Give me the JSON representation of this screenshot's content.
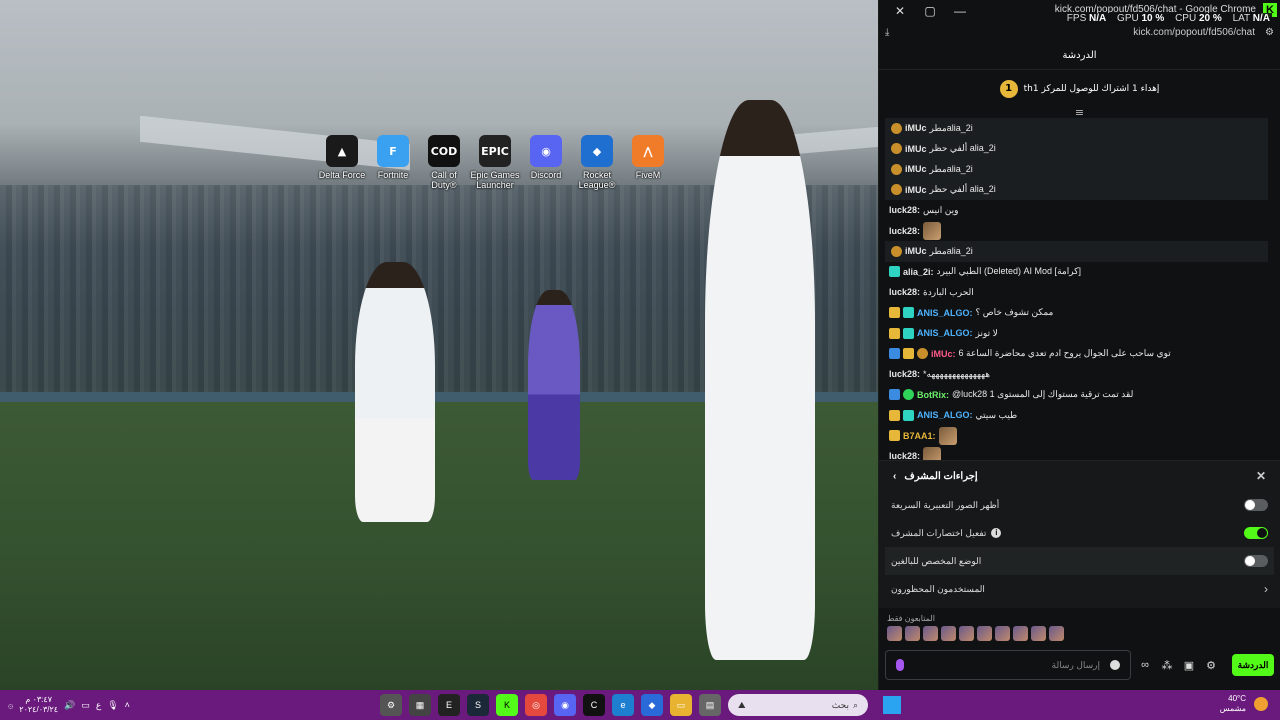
{
  "desktop": {
    "icons": [
      {
        "label": "Delta Force",
        "icon": "delta-force-icon",
        "color": "#1a1a1a",
        "glyph": "▲"
      },
      {
        "label": "Fortnite",
        "icon": "fortnite-icon",
        "color": "#3aa0f0",
        "glyph": "F"
      },
      {
        "label": "Call of Duty®",
        "icon": "call-of-duty-icon",
        "color": "#111111",
        "glyph": "COD"
      },
      {
        "label": "Epic Games Launcher",
        "icon": "epic-games-icon",
        "color": "#222222",
        "glyph": "EPIC"
      },
      {
        "label": "Discord",
        "icon": "discord-icon",
        "color": "#5865f2",
        "glyph": "◉"
      },
      {
        "label": "Rocket League®",
        "icon": "rocket-league-icon",
        "color": "#1e6fd0",
        "glyph": "◆"
      },
      {
        "label": "FiveM",
        "icon": "fivem-icon",
        "color": "#f07c2a",
        "glyph": "⋀"
      }
    ]
  },
  "browser": {
    "title": "kick.com/popout/fd506/chat - Google Chrome",
    "url": "kick.com/popout/fd506/chat",
    "stats": {
      "fps_label": "FPS",
      "fps": "N/A",
      "gpu_label": "GPU",
      "gpu": "10 %",
      "cpu_label": "CPU",
      "cpu": "20 %",
      "lat_label": "LAT",
      "lat": "N/A"
    }
  },
  "chat": {
    "header": "الدردشة",
    "goal_number": "1",
    "goal_text": "thإهداء 1 اشتراك للوصول للمركز 1",
    "messages": [
      {
        "user": "iMUc",
        "text": "مطرalia_2i",
        "badges": [
          "sub"
        ],
        "hl": true
      },
      {
        "user": "iMUc",
        "text": "ألفي حظر alia_2i",
        "badges": [
          "sub"
        ],
        "hl": true
      },
      {
        "user": "iMUc",
        "text": "مطرalia_2i",
        "badges": [
          "sub"
        ],
        "hl": true
      },
      {
        "user": "iMUc",
        "text": "ألفي حظر alia_2i",
        "badges": [
          "sub"
        ],
        "hl": true
      },
      {
        "user": "luck28:",
        "text": "وين انيس",
        "badges": [],
        "hl": false
      },
      {
        "user": "luck28:",
        "text": "",
        "badges": [],
        "emote": true,
        "hl": false
      },
      {
        "user": "iMUc",
        "text": "مطرalia_2i",
        "badges": [
          "sub"
        ],
        "hl": true
      },
      {
        "user": "alia_2i:",
        "text": "الطبي البيرد (Deleted) AI Mod [كرامة]",
        "badges": [
          "cyan"
        ],
        "hl": false
      },
      {
        "user": "luck28:",
        "text": "الحرب الباردة",
        "badges": [],
        "hl": false
      },
      {
        "user": "ANIS_ALGO:",
        "text": "ممكن تشوف خاص ؟",
        "badges": [
          "gold",
          "cyan"
        ],
        "hl": false,
        "color": "#4fb3ff"
      },
      {
        "user": "ANIS_ALGO:",
        "text": "لا تونز",
        "badges": [
          "gold",
          "cyan"
        ],
        "hl": false,
        "color": "#4fb3ff"
      },
      {
        "user": "iMUc:",
        "text": "توي ساحب على الجوال يروح ادم تعدي محاضرة الساعة 6",
        "badges": [
          "blue",
          "gold",
          "sub"
        ],
        "hl": false,
        "color": "#ff5a8a"
      },
      {
        "user": "luck28:",
        "text": "*ههههههههههههههه",
        "badges": [],
        "hl": false
      },
      {
        "user": "BotRix:",
        "text": "@luck28 لقد تمت ترقية مستواك إلى المستوى 1",
        "badges": [
          "blue",
          "green"
        ],
        "hl": false,
        "color": "#6cf06c"
      },
      {
        "user": "ANIS_ALGO:",
        "text": "طيب سيتي",
        "badges": [
          "gold",
          "cyan"
        ],
        "hl": false,
        "color": "#4fb3ff"
      },
      {
        "user": "B7AA1:",
        "text": "",
        "badges": [
          "gold"
        ],
        "emote": true,
        "hl": false,
        "color": "#e7b73a"
      },
      {
        "user": "luck28:",
        "text": "",
        "badges": [],
        "emote": true,
        "hl": false
      }
    ]
  },
  "mod_panel": {
    "title": "إجراءات المشرف",
    "rows": [
      {
        "label": "أظهر الصور التعبيرية السريعة",
        "toggle": false
      },
      {
        "label": "تفعيل اختصارات المشرف",
        "toggle": true,
        "info": true
      },
      {
        "label": "الوضع المخصص للبالغين",
        "toggle": false,
        "hover": true
      },
      {
        "label": "المستخدمون المحظورون",
        "chevron": true
      }
    ]
  },
  "subscribers_label": "المتابعون فقط",
  "input": {
    "placeholder": "إرسال رسالة",
    "send_label": "الدردشة"
  },
  "taskbar": {
    "time": "٠٣:٤٧ م",
    "date": "٢٠٢٤/٠٣/٢٤",
    "lang": "ع",
    "search_placeholder": "بحث",
    "weather_temp": "40°C",
    "weather_desc": "مشمس"
  }
}
